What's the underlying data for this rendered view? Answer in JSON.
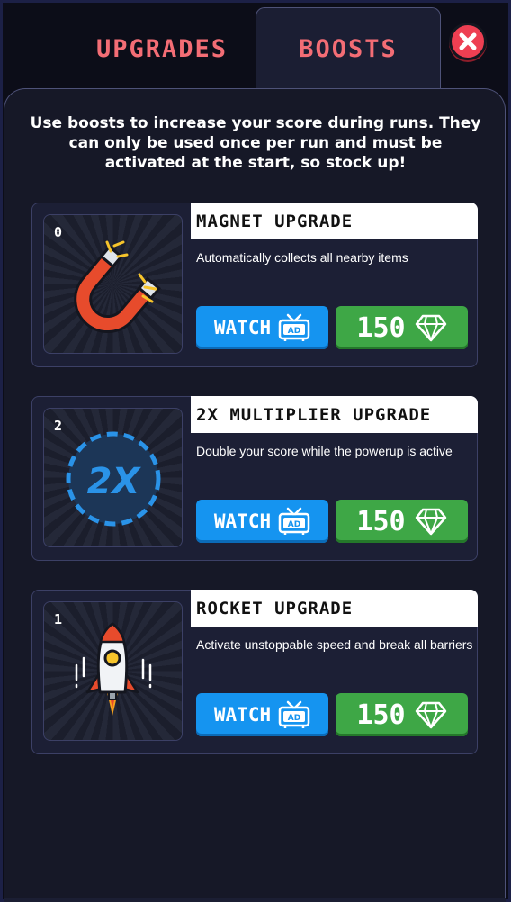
{
  "tabs": [
    {
      "label": "UPGRADES",
      "active": false
    },
    {
      "label": "BOOSTS",
      "active": true
    }
  ],
  "close_icon": "close-x-icon",
  "intro_text": "Use boosts to increase your score during runs. They can only be used once per run and must be activated at the start, so stock up!",
  "boosts": [
    {
      "count": "0",
      "title": "MAGNET UPGRADE",
      "description": "Automatically collects all nearby items",
      "watch_label": "WATCH",
      "price": "150",
      "icon": "magnet-icon"
    },
    {
      "count": "2",
      "title": "2X MULTIPLIER UPGRADE",
      "description": "Double your score while the powerup is active",
      "watch_label": "WATCH",
      "price": "150",
      "icon": "multiplier-2x-icon",
      "icon_text": "2X"
    },
    {
      "count": "1",
      "title": "ROCKET UPGRADE",
      "description": "Activate unstoppable speed and break all barriers",
      "watch_label": "WATCH",
      "price": "150",
      "icon": "rocket-icon"
    }
  ],
  "colors": {
    "tab_text": "#f36d75",
    "watch_button": "#1594f0",
    "buy_button": "#3ea746",
    "close_button": "#ee3f52",
    "multiplier_blue": "#2a93e8"
  }
}
